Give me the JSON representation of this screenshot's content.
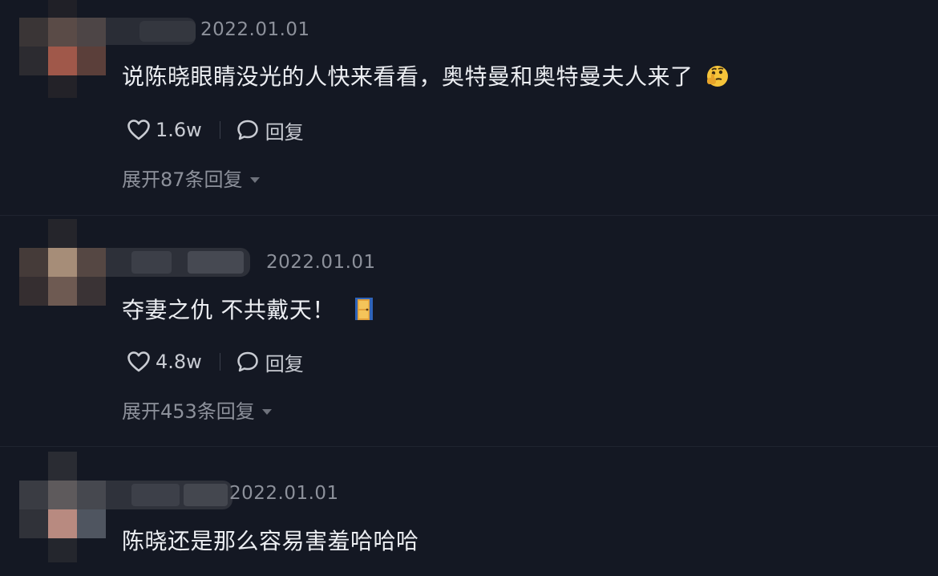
{
  "comments": [
    {
      "date": "2022.01.01",
      "text": "说陈晓眼睛没光的人快来看看，奥特曼和奥特曼夫人来了",
      "emoji": "thinking-face-emoji",
      "likes": "1.6w",
      "reply_label": "回复",
      "expand_label": "展开87条回复"
    },
    {
      "date": "2022.01.01",
      "text": "夺妻之仇 不共戴天！",
      "emoji": "door-emoji",
      "likes": "4.8w",
      "reply_label": "回复",
      "expand_label": "展开453条回复"
    },
    {
      "date": "2022.01.01",
      "text": "陈晓还是那么容易害羞哈哈哈"
    }
  ],
  "colors": {
    "background": "#141823",
    "text": "#eceef2",
    "muted": "#8d919b"
  }
}
